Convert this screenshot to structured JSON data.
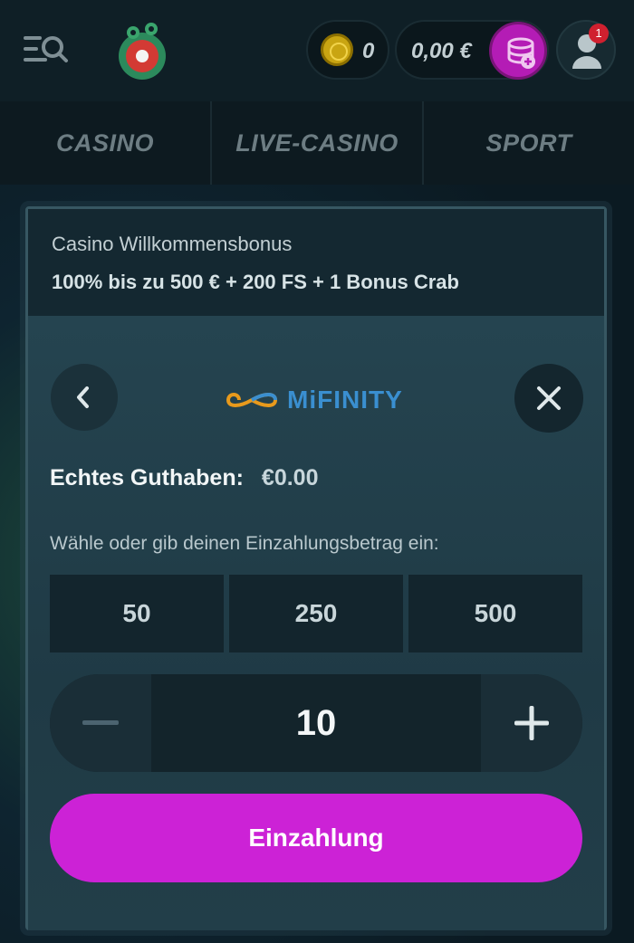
{
  "header": {
    "coins": "0",
    "balance": "0,00 €",
    "notifications": "1"
  },
  "nav": {
    "tabs": [
      "CASINO",
      "LIVE-CASINO",
      "SPORT"
    ]
  },
  "modal": {
    "bonus_title": "Casino Willkommensbonus",
    "bonus_offer": "100% bis zu 500 € + 200 FS + 1 Bonus Crab",
    "provider": "MiFINITY",
    "real_balance_label": "Echtes Guthaben:",
    "real_balance_value": "€0.00",
    "prompt": "Wähle oder gib deinen Einzahlungsbetrag ein:",
    "presets": [
      "50",
      "250",
      "500"
    ],
    "amount": "10",
    "deposit_label": "Einzahlung"
  },
  "colors": {
    "accent": "#cc22d6",
    "provider_blue": "#3a8fd0",
    "background": "#0f1f26"
  },
  "icons": {
    "menu": "search-menu-icon",
    "logo": "crab-logo",
    "coin": "coin-icon",
    "deposit": "coin-stack-icon",
    "avatar": "user-icon",
    "back": "chevron-left-icon",
    "close": "close-icon",
    "minus": "minus-icon",
    "plus": "plus-icon"
  }
}
